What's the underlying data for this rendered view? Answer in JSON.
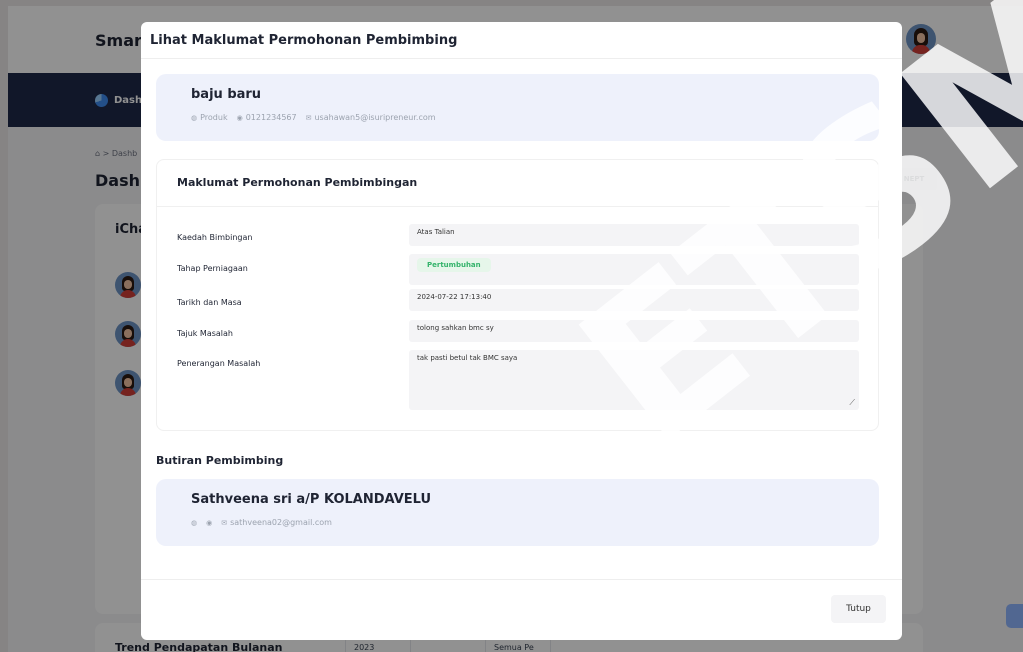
{
  "app": {
    "brand": "Smart",
    "nav_item": "Dash",
    "breadcrumb": "⌂ > Dashb",
    "page_title": "Dashb",
    "nept_label": "NEPT"
  },
  "background_cards": {
    "ichat_title": "iCha",
    "trend_title": "Trend Pendapatan Bulanan",
    "trend_year": "2023",
    "trend_filter": "Semua Pe"
  },
  "modal": {
    "title": "Lihat Maklumat Permohonan Pembimbing",
    "applicant": {
      "name": "baju baru",
      "category": "Produk",
      "phone": "0121234567",
      "email": "usahawan5@isuripreneur.com"
    },
    "info_title": "Maklumat Permohonan Pembimbingan",
    "fields": {
      "kaedah_label": "Kaedah Bimbingan",
      "kaedah_value": "Atas Talian",
      "tahap_label": "Tahap Perniagaan",
      "tahap_value": "Pertumbuhan",
      "tarikh_label": "Tarikh dan Masa",
      "tarikh_value": "2024-07-22 17:13:40",
      "tajuk_label": "Tajuk Masalah",
      "tajuk_value": "tolong sahkan bmc sy",
      "penerangan_label": "Penerangan Masalah",
      "penerangan_value": "tak pasti betul tak BMC saya"
    },
    "mentor_section_title": "Butiran Pembimbing",
    "mentor": {
      "name": "Sathveena sri a/P KOLANDAVELU",
      "email": "sathveena02@gmail.com"
    },
    "close_label": "Tutup"
  },
  "watermark": "ETSM",
  "colors": {
    "navbar": "#1e2a49",
    "card_tint": "#eef1fb",
    "status_pill_bg": "#e6f6ea",
    "status_pill_text": "#34b36b"
  }
}
